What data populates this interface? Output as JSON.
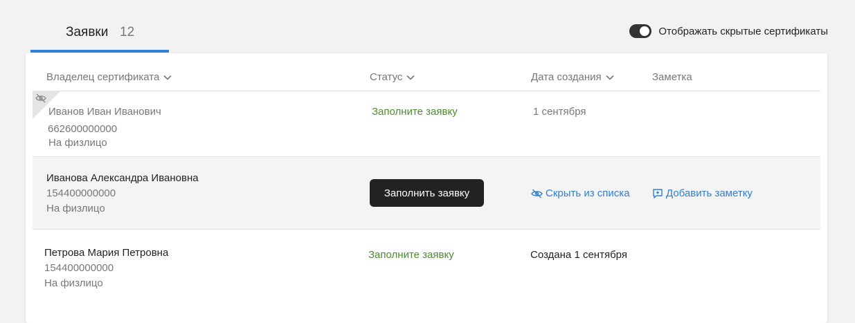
{
  "tabs": [
    {
      "label": "Заявки",
      "count": "12"
    }
  ],
  "toggle": {
    "label": "Отображать скрытые сертификаты",
    "on": true
  },
  "table": {
    "columns": {
      "owner": "Владелец сертификата",
      "status": "Статус",
      "created": "Дата создания",
      "note": "Заметка"
    },
    "rows": [
      {
        "name": "Иванов Иван Иванович",
        "inn": "662600000000",
        "type": "На физлицо",
        "status": "Заполните заявку",
        "date": "1 сентября",
        "hidden": true
      },
      {
        "name": "Иванова Александра Ивановна",
        "inn": "154400000000",
        "type": "На физлицо",
        "button": "Заполнить заявку",
        "hide_link": "Скрыть из списка",
        "note_link": "Добавить заметку"
      },
      {
        "name": "Петрова Мария Петровна",
        "inn": "154400000000",
        "type": "На физлицо",
        "status": "Заполните заявку",
        "date": "Создана 1 сентября"
      }
    ]
  },
  "colors": {
    "accent": "#2f7fd6",
    "status_green": "#4c8a2f",
    "button_dark": "#222222"
  }
}
